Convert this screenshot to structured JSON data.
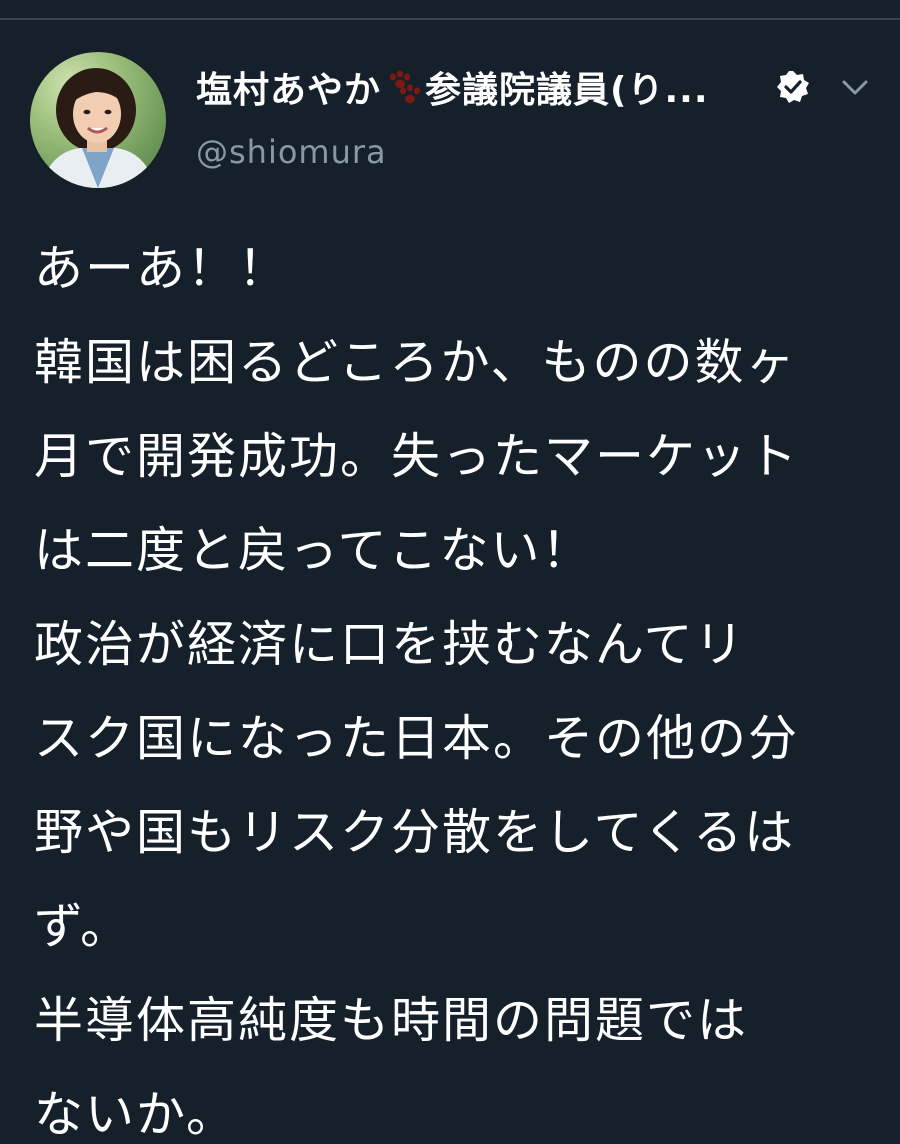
{
  "tweet": {
    "author": {
      "name_part1": "塩村あやか",
      "name_part2": "参議院議員(り...",
      "avatar_icon": "avatar-photo",
      "paw_icon": "paw-prints-icon",
      "verified_icon": "verified-badge-icon",
      "menu_icon": "chevron-down-icon",
      "handle": "@shiomura"
    },
    "lines": [
      "あーあ！！",
      "韓国は困るどころか、ものの数ヶ",
      "月で開発成功。失ったマーケット",
      "は二度と戻ってこない！",
      "政治が経済に口を挟むなんてリ",
      "スク国になった日本。その他の分",
      "野や国もリスク分散をしてくるは",
      "ず。",
      "半導体高純度も時間の問題では",
      "ないか。"
    ]
  },
  "colors": {
    "background": "#15202b",
    "text": "#ffffff",
    "secondary_text": "#8899a6",
    "paw": "#7a1a12",
    "divider": "#38444d"
  }
}
